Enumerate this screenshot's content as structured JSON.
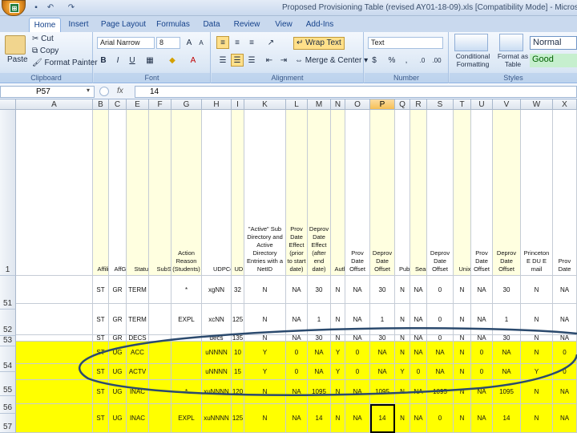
{
  "window": {
    "title": "Proposed Provisioning Table (revised AY01-18-09).xls  [Compatibility Mode] - Microsoft Ex",
    "office_icon": "office-logo-icon"
  },
  "quick_access": [
    "save-icon",
    "undo-icon",
    "redo-icon"
  ],
  "tabs": [
    "Home",
    "Insert",
    "Page Layout",
    "Formulas",
    "Data",
    "Review",
    "View",
    "Add-Ins"
  ],
  "active_tab": "Home",
  "clipboard": {
    "paste": "Paste",
    "cut": "Cut",
    "copy": "Copy",
    "format_painter": "Format Painter",
    "label": "Clipboard"
  },
  "font": {
    "name": "Arial Narrow",
    "size": "8",
    "bold": "B",
    "italic": "I",
    "underline": "U",
    "label": "Font"
  },
  "alignment": {
    "wrap_text": "Wrap Text",
    "merge_center": "Merge & Center",
    "label": "Alignment"
  },
  "number": {
    "format": "Text",
    "currency": "$",
    "percent": "%",
    "comma": ",",
    "label": "Number"
  },
  "styles": {
    "conditional": "Conditional Formatting",
    "format_table": "Format as Table",
    "normal": "Normal",
    "good": "Good",
    "label": "Styles"
  },
  "formula_bar": {
    "name_box": "P57",
    "value": "14",
    "fx": "fx"
  },
  "columns": [
    "A",
    "B",
    "C",
    "E",
    "F",
    "G",
    "H",
    "I",
    "K",
    "L",
    "M",
    "N",
    "O",
    "P",
    "Q",
    "R",
    "S",
    "T",
    "U",
    "V",
    "W",
    "X"
  ],
  "selected_column": "P",
  "header_row": {
    "row_num": "1",
    "B": "Affiliation",
    "C": "A ff G roup",
    "E": "Status Code",
    "F": "Sub Status Code",
    "G": "Action Reason (Students)",
    "H": "UDP Code",
    "I": "UDP Priority",
    "K": "\"Active\" Sub Directory and Active Directory Entries with a NetID",
    "L": "Prov Date Effect (prior to start date)",
    "M": "Deprov Date Effect (after end date)",
    "N": "Authentication",
    "O": "Prov Date Offset",
    "P": "Deprov Date Offset",
    "Q": "Publishable",
    "R": "Searchable",
    "S": "Deprov Date Offset",
    "T": "Unix Acct",
    "U": "Prov Date Offset",
    "V": "Deprov Date Offset",
    "W": "Princeton E DU E mail",
    "X": "Prov Date"
  },
  "rows": [
    {
      "num": "51",
      "style": "plain",
      "cells": {
        "B": "ST",
        "C": "GR",
        "E": "TERM",
        "F": "",
        "G": "*",
        "H": "xgNN",
        "I": "32",
        "K": "N",
        "L": "NA",
        "M": "30",
        "N": "N",
        "O": "NA",
        "P": "30",
        "Q": "N",
        "R": "NA",
        "S": "0",
        "T": "N",
        "U": "NA",
        "V": "30",
        "W": "N",
        "X": "NA"
      }
    },
    {
      "num": "52",
      "style": "plain",
      "cells": {
        "B": "ST",
        "C": "GR",
        "E": "TERM",
        "F": "",
        "G": "EXPL",
        "H": "xcNN",
        "I": "125",
        "K": "N",
        "L": "NA",
        "M": "1",
        "N": "N",
        "O": "NA",
        "P": "1",
        "Q": "N",
        "R": "NA",
        "S": "0",
        "T": "N",
        "U": "NA",
        "V": "1",
        "W": "N",
        "X": "NA"
      }
    },
    {
      "num": "53",
      "style": "plain",
      "cells": {
        "B": "ST",
        "C": "GR",
        "E": "DECS",
        "F": "",
        "G": "",
        "H": "decs",
        "I": "135",
        "K": "N",
        "L": "NA",
        "M": "30",
        "N": "N",
        "O": "NA",
        "P": "30",
        "Q": "N",
        "R": "NA",
        "S": "0",
        "T": "N",
        "U": "NA",
        "V": "30",
        "W": "N",
        "X": "NA"
      }
    },
    {
      "num": "54",
      "style": "yellow",
      "cells": {
        "B": "ST",
        "C": "UG",
        "E": "ACC",
        "F": "",
        "G": "",
        "H": "uNNNN",
        "I": "10",
        "K": "Y",
        "L": "0",
        "M": "NA",
        "N": "Y",
        "O": "0",
        "P": "NA",
        "Q": "N",
        "R": "NA",
        "S": "NA",
        "T": "N",
        "U": "0",
        "V": "NA",
        "W": "N",
        "X": "0"
      }
    },
    {
      "num": "55",
      "style": "yellow",
      "cells": {
        "B": "ST",
        "C": "UG",
        "E": "ACTV",
        "F": "",
        "G": "",
        "H": "uNNNN",
        "I": "15",
        "K": "Y",
        "L": "0",
        "M": "NA",
        "N": "Y",
        "O": "0",
        "P": "NA",
        "Q": "Y",
        "R": "0",
        "S": "NA",
        "T": "N",
        "U": "0",
        "V": "NA",
        "W": "Y",
        "X": "0"
      }
    },
    {
      "num": "56",
      "style": "yellow",
      "cells": {
        "B": "ST",
        "C": "UG",
        "E": "INAC",
        "F": "",
        "G": "*",
        "H": "xuNNNN",
        "I": "120",
        "K": "N",
        "L": "NA",
        "M": "1095",
        "N": "N",
        "O": "NA",
        "P": "1095",
        "Q": "N",
        "R": "NA",
        "S": "1095",
        "T": "N",
        "U": "NA",
        "V": "1095",
        "W": "N",
        "X": "NA"
      }
    },
    {
      "num": "57",
      "style": "yellow",
      "cells": {
        "B": "ST",
        "C": "UG",
        "E": "INAC",
        "F": "",
        "G": "EXPL",
        "H": "xuNNNN",
        "I": "125",
        "K": "N",
        "L": "NA",
        "M": "14",
        "N": "N",
        "O": "NA",
        "P": "14",
        "Q": "N",
        "R": "NA",
        "S": "0",
        "T": "N",
        "U": "NA",
        "V": "14",
        "W": "N",
        "X": "NA"
      }
    }
  ],
  "colors": {
    "highlight": "#ffff00",
    "header_pale": "#ffffe0",
    "ellipse": "#2b4a6e"
  }
}
